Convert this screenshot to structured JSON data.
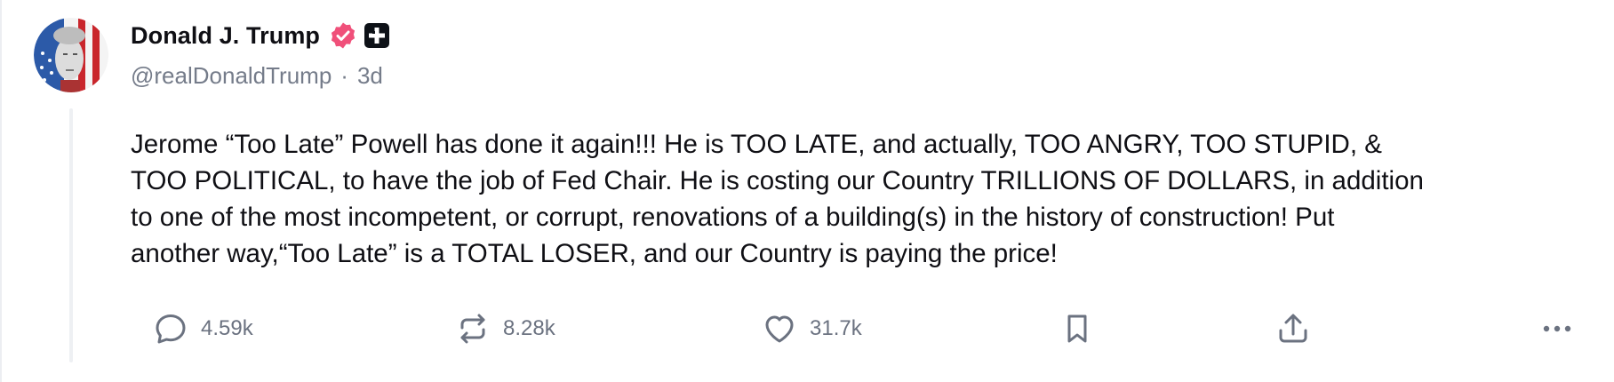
{
  "post": {
    "author": {
      "display_name": "Donald J. Trump",
      "handle": "@realDonaldTrump",
      "separator": "·",
      "age": "3d",
      "verified_icon": "verified-badge-icon",
      "verified_color": "#f0507a",
      "extra_badge_icon": "plus-badge-icon"
    },
    "text": "Jerome “Too Late” Powell has done it again!!! He is TOO LATE, and actually, TOO ANGRY, TOO STUPID, &\nTOO POLITICAL, to have the job of Fed Chair. He is costing our Country TRILLIONS OF DOLLARS, in addition\nto one of the most incompetent, or corrupt, renovations of a building(s) in the history of construction! Put\nanother way,“Too Late” is a TOTAL LOSER, and our Country is paying the price!",
    "actions": {
      "replies": {
        "icon": "reply-bubble-icon",
        "count": "4.59k"
      },
      "reposts": {
        "icon": "repost-icon",
        "count": "8.28k"
      },
      "likes": {
        "icon": "heart-icon",
        "count": "31.7k"
      },
      "bookmark": {
        "icon": "bookmark-icon"
      },
      "share": {
        "icon": "share-icon"
      },
      "more": {
        "icon": "more-dots-icon"
      }
    }
  }
}
